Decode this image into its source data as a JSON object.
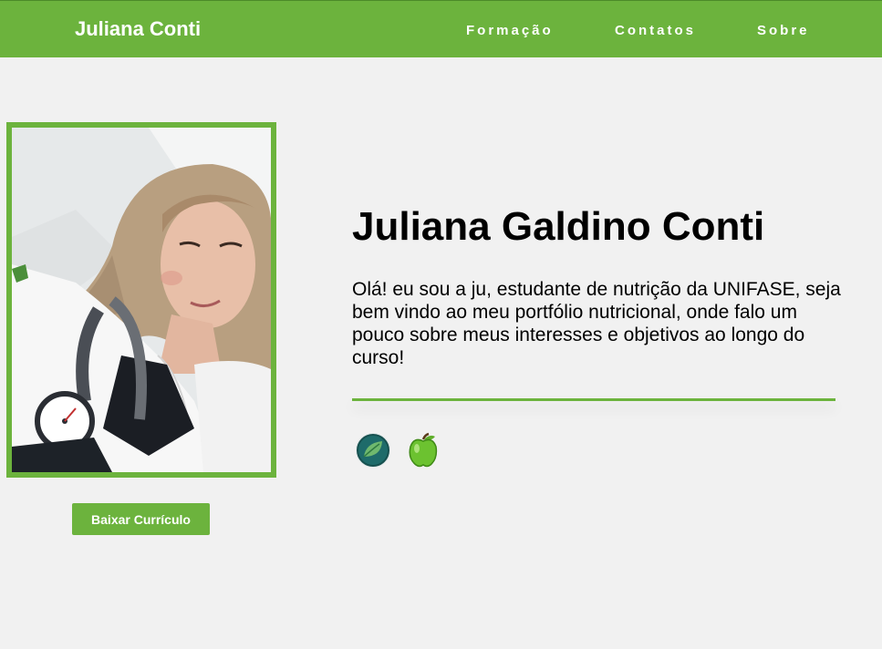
{
  "navbar": {
    "brand": "Juliana Conti",
    "links": [
      "Formação",
      "Contatos",
      "Sobre"
    ]
  },
  "profile": {
    "photo_icon": "profile-photo",
    "download_label": "Baixar Currículo"
  },
  "hero": {
    "title": "Juliana Galdino Conti",
    "intro": "Olá! eu sou a ju, estudante de nutrição da UNIFASE, seja bem vindo ao meu portfólio nutricional, onde falo um pouco sobre meus interesses e objetivos ao longo do curso!"
  },
  "icons": [
    "leaf-icon",
    "apple-icon"
  ],
  "colors": {
    "accent": "#6cb33d",
    "background": "#f1f1f1",
    "text": "#000000"
  }
}
